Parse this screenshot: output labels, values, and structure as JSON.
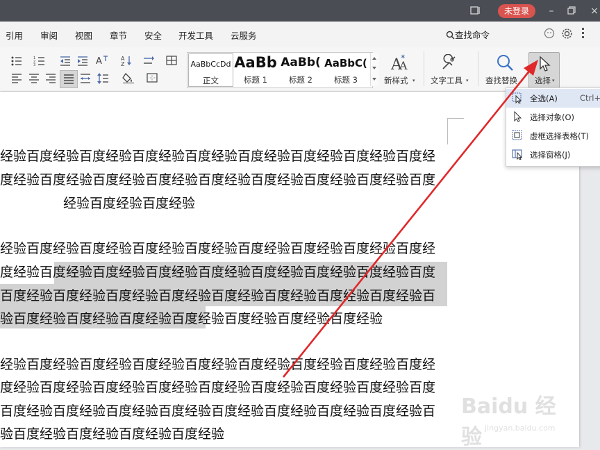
{
  "titlebar": {
    "login_label": "未登录"
  },
  "menubar": {
    "items": [
      "引用",
      "审阅",
      "视图",
      "章节",
      "安全",
      "开发工具",
      "云服务"
    ],
    "search_label": "查找命令"
  },
  "ribbon": {
    "styles": [
      {
        "sample": "AaBbCcDd",
        "name": "正文"
      },
      {
        "sample": "AaBb",
        "name": "标题 1"
      },
      {
        "sample": "AaBb(",
        "name": "标题 2"
      },
      {
        "sample": "AaBbC(",
        "name": "标题 3"
      }
    ],
    "new_style_label": "新样式",
    "text_tool_label": "文字工具",
    "find_replace_label": "查找替换",
    "select_label": "选择"
  },
  "dropdown": {
    "items": [
      {
        "label": "全选(A)",
        "shortcut": "Ctrl+A"
      },
      {
        "label": "选择对象(O)",
        "shortcut": ""
      },
      {
        "label": "虚框选择表格(T)",
        "shortcut": ""
      },
      {
        "label": "选择窗格(J)",
        "shortcut": ""
      }
    ]
  },
  "document": {
    "lines": [
      "经验百度经验百度经验百度经验百度经验百度经验百度经验百度经验百度经",
      "度经验百度经验百度经验百度经验百度经验百度经验百度经验百度经验百度",
      "经验百度经验百度经验",
      "经验百度经验百度经验百度经验百度经验百度经验百度经验百度经验百度经",
      "度经验百度经验百度经验百度经验百度经验百度经验百度经验百度经验百度",
      "百度经验百度经验百度经验百度经验百度经验百度经验百度经验百度经验百",
      "验百度经验百度经验百度经验百度经验百度经验百度经验百度经验",
      "经验百度经验百度经验百度经验百度经验百度经验百度经验百度经验百度经",
      "度经验百度经验百度经验百度经验百度经验百度经验百度经验百度经验百度",
      "百度经验百度经验百度经验百度经验百度经验百度经验百度经验百度经验百",
      "验百度经验百度经验百度经验百度经验"
    ]
  },
  "watermark": {
    "brand": "Baidu 经验",
    "url": "jingyan.baidu.com"
  },
  "colors": {
    "titlebar": "#4a4d54",
    "login": "#d9534f",
    "arrow": "#e0282a",
    "selection": "#d2d2d2"
  }
}
